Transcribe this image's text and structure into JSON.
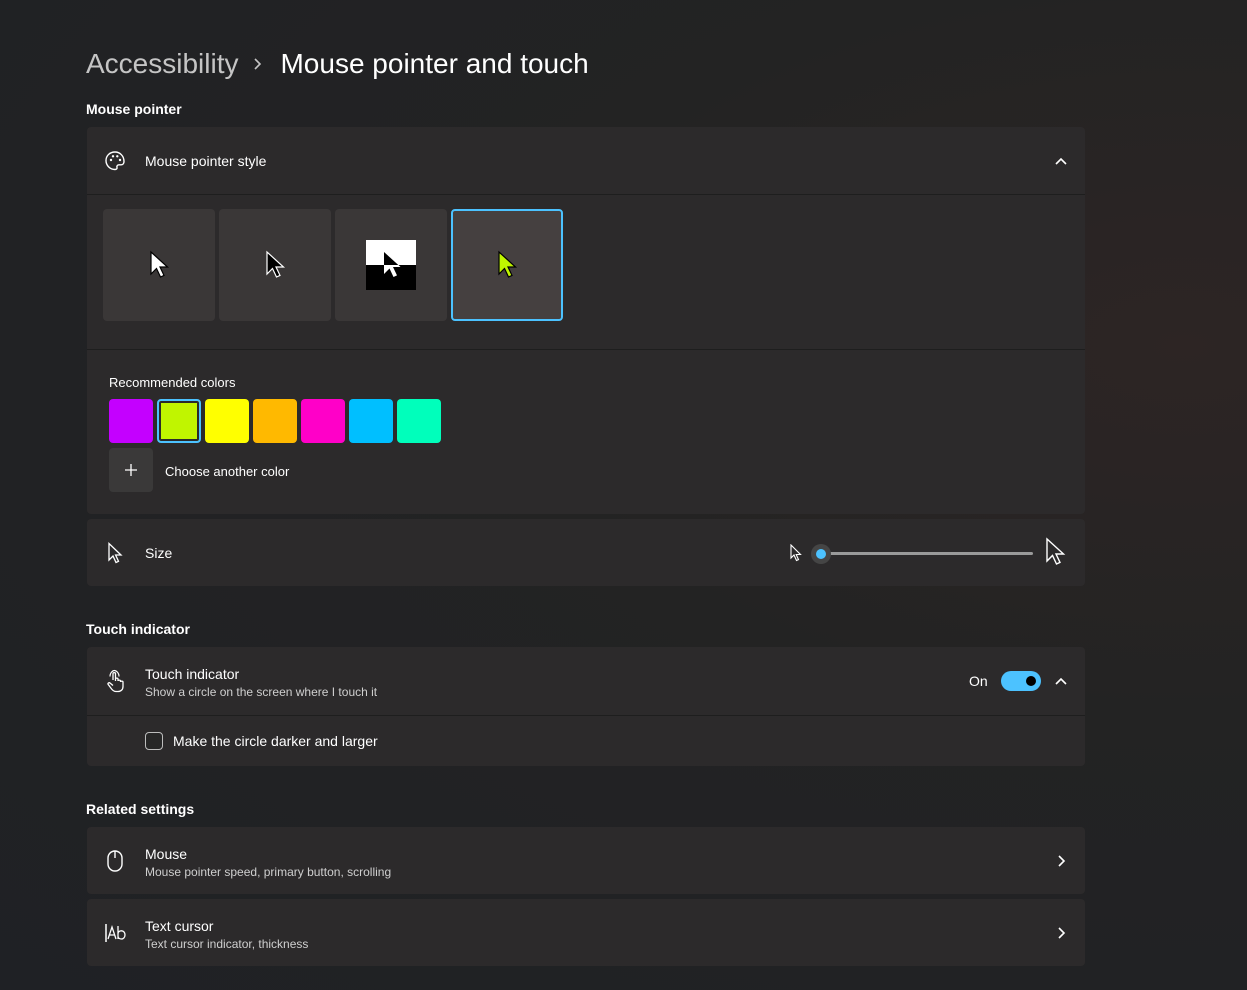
{
  "breadcrumb": {
    "parent": "Accessibility",
    "current": "Mouse pointer and touch"
  },
  "mouse_pointer": {
    "section_title": "Mouse pointer",
    "style": {
      "title": "Mouse pointer style",
      "options": [
        {
          "name": "white",
          "selected": false
        },
        {
          "name": "black",
          "selected": false
        },
        {
          "name": "inverted",
          "selected": false
        },
        {
          "name": "custom",
          "selected": true,
          "color": "#c0f500"
        }
      ]
    },
    "colors": {
      "label": "Recommended colors",
      "swatches": [
        "#c400ff",
        "#c0f500",
        "#ffff00",
        "#ffb900",
        "#ff00c8",
        "#00bfff",
        "#00ffbb"
      ],
      "selected_index": 1,
      "choose_label": "Choose another color"
    },
    "size": {
      "label": "Size",
      "value": 1,
      "min": 1,
      "max": 15
    }
  },
  "touch": {
    "section_title": "Touch indicator",
    "indicator": {
      "title": "Touch indicator",
      "subtitle": "Show a circle on the screen where I touch it",
      "state": "On",
      "enabled": true
    },
    "darker": {
      "label": "Make the circle darker and larger",
      "checked": false
    }
  },
  "related": {
    "section_title": "Related settings",
    "items": [
      {
        "title": "Mouse",
        "subtitle": "Mouse pointer speed, primary button, scrolling"
      },
      {
        "title": "Text cursor",
        "subtitle": "Text cursor indicator, thickness"
      }
    ]
  },
  "colors": {
    "accent": "#4cc2ff",
    "card": "#2c2a2b",
    "background": "#202020"
  }
}
